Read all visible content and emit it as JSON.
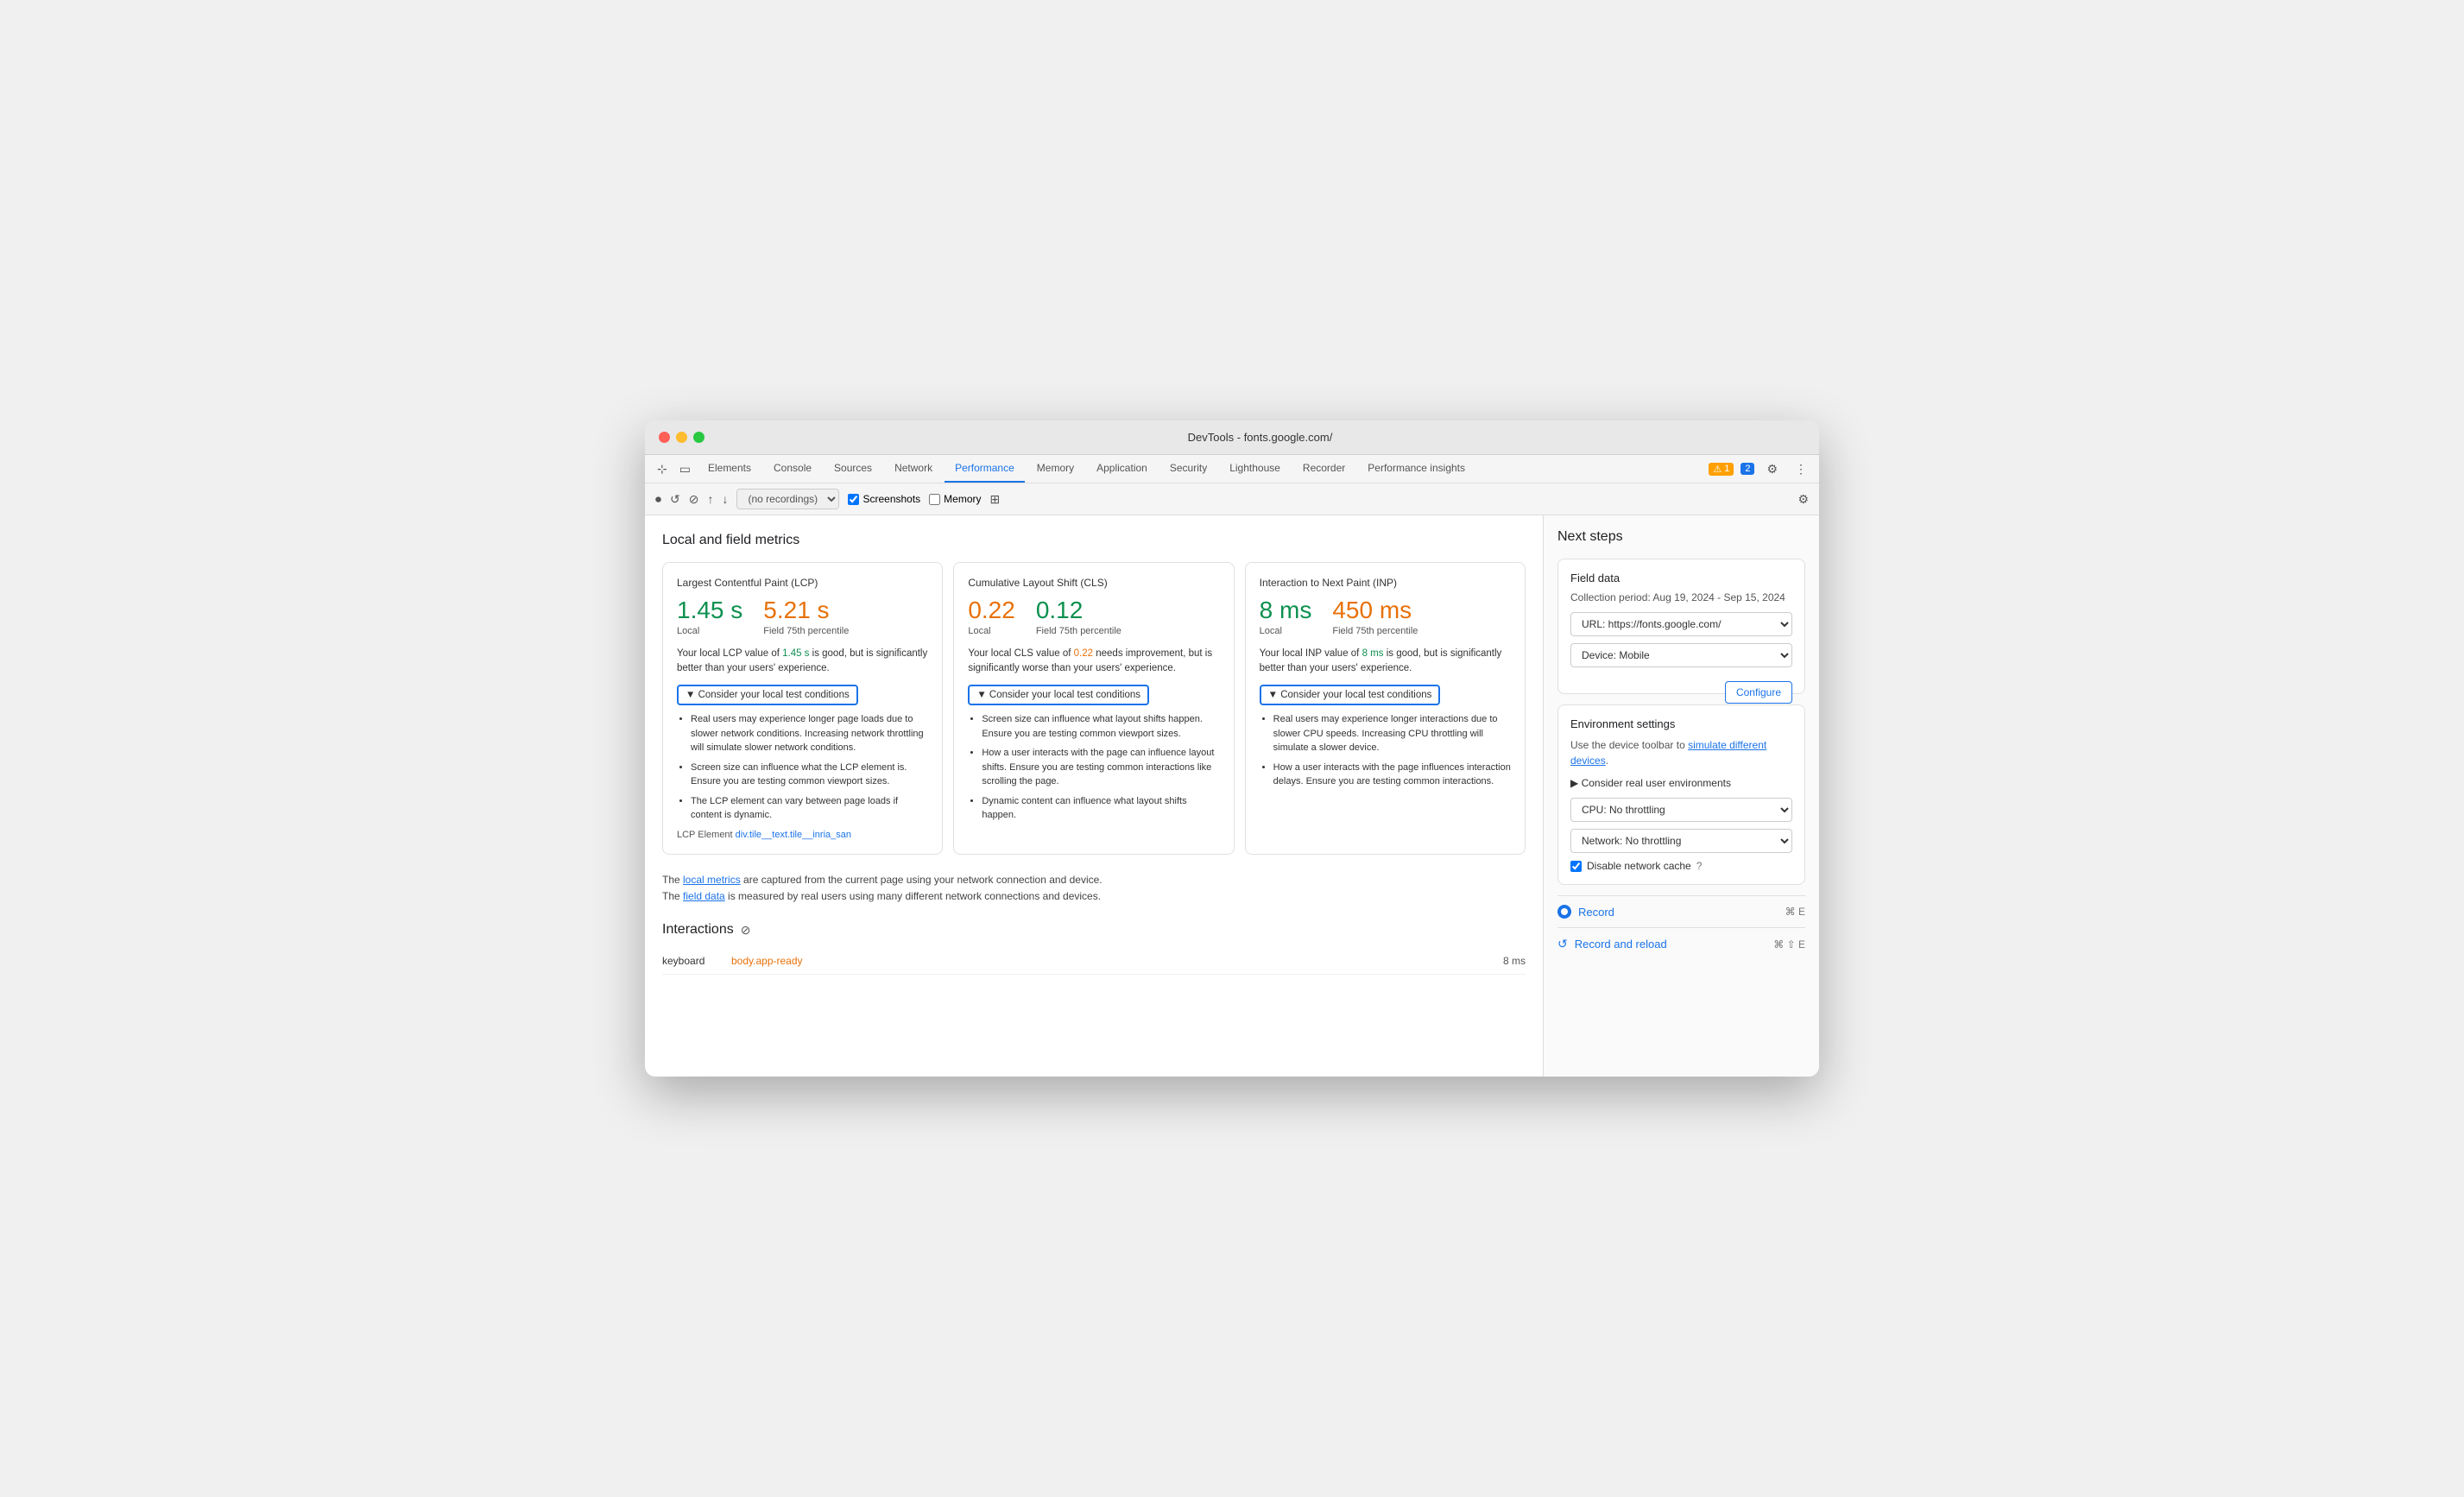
{
  "window": {
    "title": "DevTools - fonts.google.com/"
  },
  "nav": {
    "tabs": [
      {
        "label": "Elements",
        "active": false
      },
      {
        "label": "Console",
        "active": false
      },
      {
        "label": "Sources",
        "active": false
      },
      {
        "label": "Network",
        "active": false
      },
      {
        "label": "Performance",
        "active": true
      },
      {
        "label": "Memory",
        "active": false
      },
      {
        "label": "Application",
        "active": false
      },
      {
        "label": "Security",
        "active": false
      },
      {
        "label": "Lighthouse",
        "active": false
      },
      {
        "label": "Recorder",
        "active": false
      },
      {
        "label": "Performance insights",
        "active": false
      }
    ],
    "warning_count": "1",
    "info_count": "2"
  },
  "toolbar": {
    "recording_placeholder": "(no recordings)",
    "screenshots_label": "Screenshots",
    "memory_label": "Memory"
  },
  "local_field_metrics": {
    "section_title": "Local and field metrics",
    "lcp": {
      "title": "Largest Contentful Paint (LCP)",
      "local_value": "1.45 s",
      "field_value": "5.21 s",
      "local_label": "Local",
      "field_label": "Field 75th percentile",
      "local_color": "green",
      "field_color": "orange",
      "description": "Your local LCP value of 1.45 s is good, but is significantly better than your users' experience.",
      "desc_highlight_local": "1.45 s",
      "consider_label": "▼ Consider your local test conditions",
      "bullet_1": "Real users may experience longer page loads due to slower network conditions. Increasing network throttling will simulate slower network conditions.",
      "bullet_2": "Screen size can influence what the LCP element is. Ensure you are testing common viewport sizes.",
      "bullet_3": "The LCP element can vary between page loads if content is dynamic.",
      "lcp_element_label": "LCP Element",
      "lcp_element_value": "div.tile__text.tile__inria_san"
    },
    "cls": {
      "title": "Cumulative Layout Shift (CLS)",
      "local_value": "0.22",
      "field_value": "0.12",
      "local_label": "Local",
      "field_label": "Field 75th percentile",
      "local_color": "orange",
      "field_color": "green",
      "description": "Your local CLS value of 0.22 needs improvement, but is significantly worse than your users' experience.",
      "desc_highlight_local": "0.22",
      "consider_label": "▼ Consider your local test conditions",
      "bullet_1": "Screen size can influence what layout shifts happen. Ensure you are testing common viewport sizes.",
      "bullet_2": "How a user interacts with the page can influence layout shifts. Ensure you are testing common interactions like scrolling the page.",
      "bullet_3": "Dynamic content can influence what layout shifts happen."
    },
    "inp": {
      "title": "Interaction to Next Paint (INP)",
      "local_value": "8 ms",
      "field_value": "450 ms",
      "local_label": "Local",
      "field_label": "Field 75th percentile",
      "local_color": "green",
      "field_color": "orange",
      "description": "Your local INP value of 8 ms is good, but is significantly better than your users' experience.",
      "desc_highlight_local": "8 ms",
      "consider_label": "▼ Consider your local test conditions",
      "bullet_1": "Real users may experience longer interactions due to slower CPU speeds. Increasing CPU throttling will simulate a slower device.",
      "bullet_2": "How a user interacts with the page influences interaction delays. Ensure you are testing common interactions."
    }
  },
  "footer": {
    "line1_before": "The ",
    "line1_link": "local metrics",
    "line1_after": " are captured from the current page using your network connection and device.",
    "line2_before": "The ",
    "line2_link": "field data",
    "line2_after": " is measured by real users using many different network connections and devices."
  },
  "interactions": {
    "section_title": "Interactions",
    "rows": [
      {
        "type": "keyboard",
        "selector": "body.app-ready",
        "time": "8 ms"
      }
    ]
  },
  "next_steps": {
    "title": "Next steps",
    "field_data": {
      "title": "Field data",
      "collection_period": "Collection period: Aug 19, 2024 - Sep 15, 2024",
      "url_label": "URL: https://fonts.google.com/",
      "device_label": "Device: Mobile",
      "configure_label": "Configure"
    },
    "environment": {
      "title": "Environment settings",
      "description_before": "Use the device toolbar to ",
      "description_link": "simulate different devices",
      "description_after": ".",
      "consider_label": "▶ Consider real user environments",
      "cpu_label": "CPU: No throttling",
      "network_label": "Network: No throttling",
      "disable_cache_label": "Disable network cache"
    },
    "record": {
      "label": "Record",
      "shortcut": "⌘ E"
    },
    "record_reload": {
      "label": "Record and reload",
      "shortcut": "⌘ ⇧ E"
    }
  }
}
